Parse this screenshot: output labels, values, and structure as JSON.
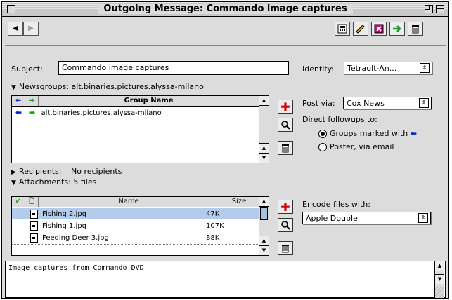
{
  "window": {
    "title": "Outgoing Message: Commando image captures"
  },
  "toolbar": {
    "back_icon": "arrow-left-icon",
    "forward_icon": "arrow-right-icon",
    "tools": [
      "calculator-icon",
      "pencil-icon",
      "red-x-icon",
      "green-arrow-icon",
      "trash-icon"
    ]
  },
  "subject": {
    "label": "Subject:",
    "value": "Commando image captures"
  },
  "identity": {
    "label": "Identity:",
    "value": "Tetrault-An..."
  },
  "newsgroups": {
    "label": "Newsgroups:",
    "value": "alt.binaries.pictures.alyssa-milano",
    "column": "Group Name",
    "rows": [
      "alt.binaries.pictures.alyssa-milano"
    ]
  },
  "post_via": {
    "label": "Post via:",
    "value": "Cox News"
  },
  "followups": {
    "label": "Direct followups to:",
    "option1": "Groups marked with",
    "option2": "Poster, via email",
    "selected": "option1"
  },
  "recipients": {
    "label": "Recipients:",
    "value": "No recipients"
  },
  "attachments": {
    "label": "Attachments: 5 files",
    "columns": {
      "name": "Name",
      "size": "Size"
    },
    "rows": [
      {
        "name": "Fishing 2.jpg",
        "size": "47K",
        "selected": true
      },
      {
        "name": "Fishing 1.jpg",
        "size": "107K",
        "selected": false
      },
      {
        "name": "Feeding Deer 3.jpg",
        "size": "88K",
        "selected": false
      }
    ]
  },
  "encode": {
    "label": "Encode files with:",
    "value": "Apple Double"
  },
  "message_body": "Image captures from Commando DVD",
  "colors": {
    "selection": "#b4ccec",
    "add": "#d40000",
    "green": "#1a9a1a",
    "blue": "#0028c8"
  }
}
